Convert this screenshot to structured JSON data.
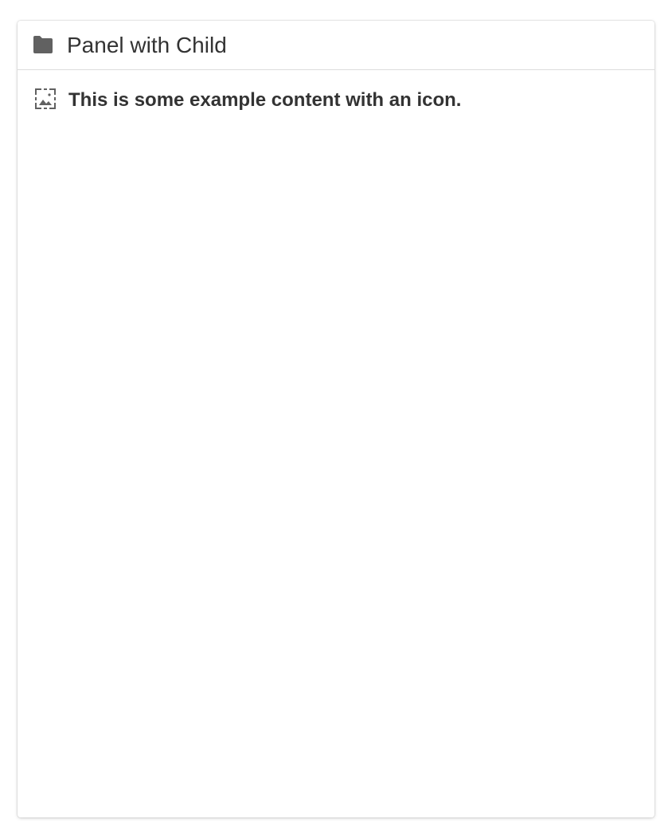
{
  "panel": {
    "title": "Panel with Child",
    "header_icon": "folder-icon",
    "content": {
      "icon": "image-placeholder-icon",
      "text": "This is some example content with an icon."
    }
  },
  "colors": {
    "text": "#333333",
    "icon": "#616161",
    "divider": "#dcdcdc",
    "background": "#ffffff"
  }
}
